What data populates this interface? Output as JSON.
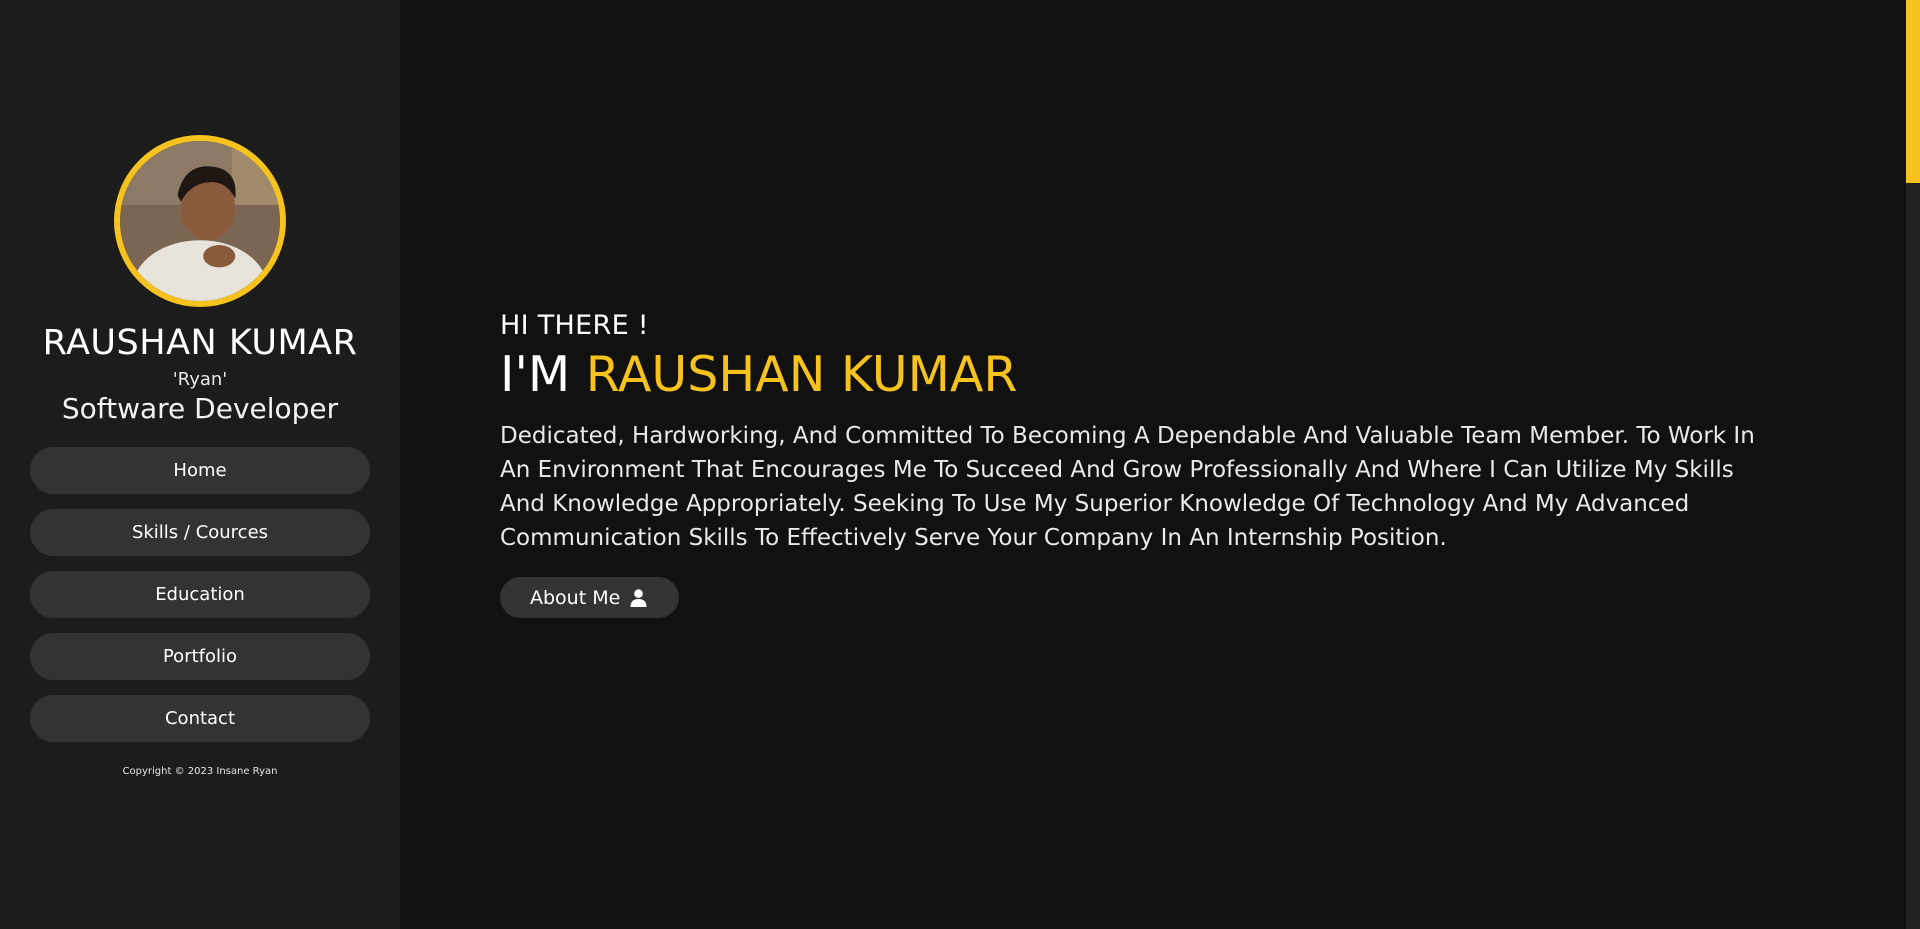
{
  "profile": {
    "name": "RAUSHAN KUMAR",
    "nickname": "'Ryan'",
    "role": "Software Developer"
  },
  "nav": {
    "items": [
      {
        "label": "Home"
      },
      {
        "label": "Skills / Cources"
      },
      {
        "label": "Education"
      },
      {
        "label": "Portfolio"
      },
      {
        "label": "Contact"
      }
    ]
  },
  "footer": {
    "copyright": "Copyright © 2023 Insane Ryan"
  },
  "hero": {
    "greeting": "HI THERE !",
    "headline_prefix": "I'M",
    "headline_name": "RAUSHAN KUMAR",
    "description": "Dedicated, Hardworking, And Committed To Becoming A Dependable And Valuable Team Member. To Work In An Environment That Encourages Me To Succeed And Grow Professionally And Where I Can Utilize My Skills And Knowledge Appropriately. Seeking To Use My Superior Knowledge Of Technology And My Advanced Communication Skills To Effectively Serve Your Company In An Internship Position.",
    "about_button": "About Me",
    "about_icon": "user-icon"
  },
  "theme": {
    "accent": "#f6c31e",
    "sidebar_bg": "#1c1c1c",
    "main_bg": "#111111",
    "button_bg": "#333333"
  }
}
